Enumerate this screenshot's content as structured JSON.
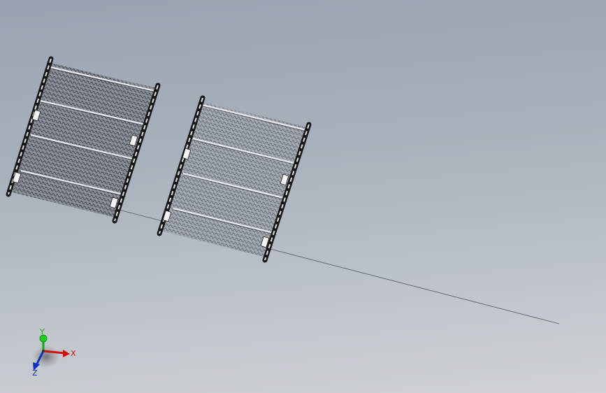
{
  "viewport": {
    "background_top": "#9aa3b1",
    "background_bottom": "#cfd3d7"
  },
  "model": {
    "panels": [
      "mesh-belt-panel",
      "mesh-belt-panel"
    ],
    "icon": "wire-mesh-conveyor-belt"
  },
  "triad": {
    "x_label": "X",
    "y_label": "Y",
    "z_label": "Z",
    "x_color": "#d01010",
    "y_color": "#10b010",
    "z_color": "#1030c0"
  }
}
